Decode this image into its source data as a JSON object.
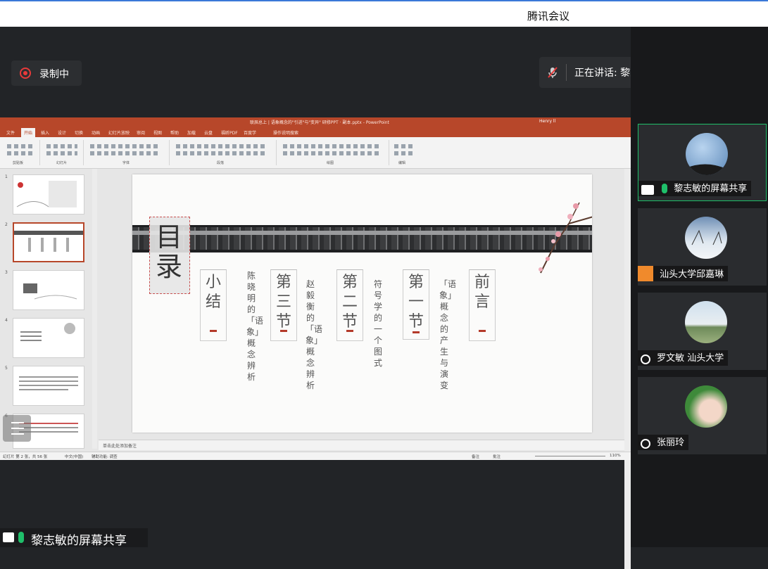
{
  "window": {
    "title": "腾讯会议"
  },
  "recording": {
    "label": "录制中"
  },
  "speaking": {
    "label": "正在讲话: 黎志敏;"
  },
  "ppt": {
    "doc_title": "联辰总上 | 语象概念的\"引进\"与\"变异\" 研修PPT · 副本.pptx  -  PowerPoint",
    "user": "Henry ll",
    "tabs": [
      "文件",
      "开始",
      "插入",
      "设计",
      "切换",
      "动画",
      "幻灯片放映",
      "审阅",
      "视图",
      "帮助",
      "加载",
      "云盘",
      "福昕PDF",
      "百度学",
      "操作说明搜索"
    ],
    "ribbon_groups": [
      "剪贴板",
      "幻灯片",
      "字体",
      "段落",
      "绘图",
      "编辑"
    ],
    "slide_numbers": [
      "1",
      "2",
      "3",
      "4",
      "5",
      "6"
    ],
    "notes_placeholder": "单击此处添加备注",
    "status": {
      "slide_info": "幻灯片 第 2 张，共 56 张",
      "lang": "中文(中国)",
      "access": "辅助功能: 调查",
      "notes": "备注",
      "comments": "批注",
      "zoom": "110%"
    },
    "slide": {
      "title": "目录",
      "sections": [
        {
          "name": "前言",
          "desc": ""
        },
        {
          "name": "第一节",
          "desc": "「语象」概念的产生与演变"
        },
        {
          "name": "第二节",
          "desc": "符号学的一个图式"
        },
        {
          "name": "第三节",
          "desc": "赵毅衡的「语象」概念辨析"
        },
        {
          "name": "小结",
          "desc": "陈晓明的「语象」概念辨析"
        }
      ]
    }
  },
  "participants": [
    {
      "name": "黎志敏的屏幕共享",
      "status": "active"
    },
    {
      "name": "汕头大学邱嘉琳",
      "status": ""
    },
    {
      "name": "罗文敏 汕头大学",
      "status": "muted"
    },
    {
      "name": "张丽玲",
      "status": "muted"
    }
  ],
  "share_tag": {
    "label": "黎志敏的屏幕共享"
  },
  "colors": {
    "ppt_red": "#b7472a",
    "speaking_green": "#1fbf6a",
    "record_red": "#e83a3a"
  }
}
